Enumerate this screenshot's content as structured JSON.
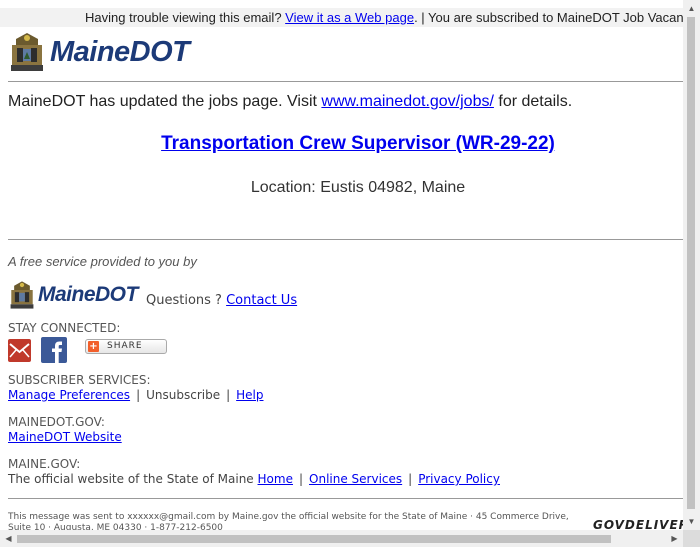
{
  "topbar": {
    "prefix": "Having trouble viewing this email?",
    "view_link": "View it as a Web page",
    "suffix": ". | You are subscribed to MaineDOT Job Vacancies"
  },
  "brand": {
    "name": "MaineDOT"
  },
  "intro": {
    "text_before": "MaineDOT has updated the jobs page. Visit ",
    "link": "www.mainedot.gov/jobs/",
    "text_after": " for details."
  },
  "job": {
    "title": "Transportation Crew Supervisor (WR-29-22)",
    "location": "Location: Eustis 04982, Maine"
  },
  "footer": {
    "free_service": "A free service provided to you by",
    "questions": "Questions ?",
    "contact": "Contact Us",
    "stay_connected": "STAY CONNECTED:",
    "share": "SHARE",
    "subscriber_services": "SUBSCRIBER SERVICES:",
    "manage_preferences": "Manage Preferences",
    "unsubscribe": "Unsubscribe",
    "help": "Help",
    "mainedot_gov": "MAINEDOT.GOV:",
    "mainedot_website": "MaineDOT Website",
    "maine_gov": "MAINE.GOV:",
    "official_text": "The official website of the State of Maine",
    "home": "Home",
    "online_services": "Online Services",
    "privacy_policy": "Privacy Policy",
    "disclaimer": "This message was sent to xxxxxx@gmail.com by Maine.gov the official website for the State of Maine · 45 Commerce Drive, Suite 10 · Augusta, ME 04330 · 1-877-212-6500",
    "govdelivery": "GOVDELIVERY"
  },
  "colors": {
    "link": "#0000ee",
    "brand": "#1c3a78",
    "email_icon": "#c0392b",
    "facebook": "#3b5998"
  }
}
